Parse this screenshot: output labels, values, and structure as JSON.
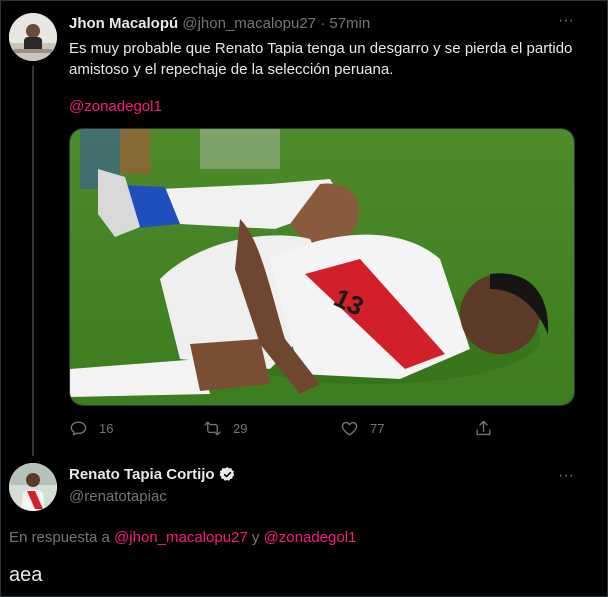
{
  "tweet1": {
    "name": "Jhon Macalopú",
    "handle": "@jhon_macalopu27",
    "separator": "·",
    "time": "57min",
    "text": "Es muy probable que Renato Tapia tenga un desgarro y se pierda el partido amistoso y el repechaje de la selección peruana.",
    "mention": "@zonadegol1",
    "image_jersey_number": "13",
    "actions": {
      "replies": "16",
      "retweets": "29",
      "likes": "77"
    }
  },
  "tweet2": {
    "name": "Renato Tapia Cortijo",
    "handle": "@renatotapiac",
    "reply_prefix": "En respuesta a",
    "reply_user1": "@jhon_macalopu27",
    "reply_joiner": "y",
    "reply_user2": "@zonadegol1",
    "text": "aea"
  },
  "more_glyph": "···",
  "colors": {
    "background": "#000000",
    "text": "#e7e9ea",
    "muted": "#71767b",
    "accent": "#f91880",
    "divider": "#2f3336"
  },
  "icons": [
    "reply-icon",
    "retweet-icon",
    "like-icon",
    "share-icon",
    "verified-icon",
    "more-icon"
  ]
}
